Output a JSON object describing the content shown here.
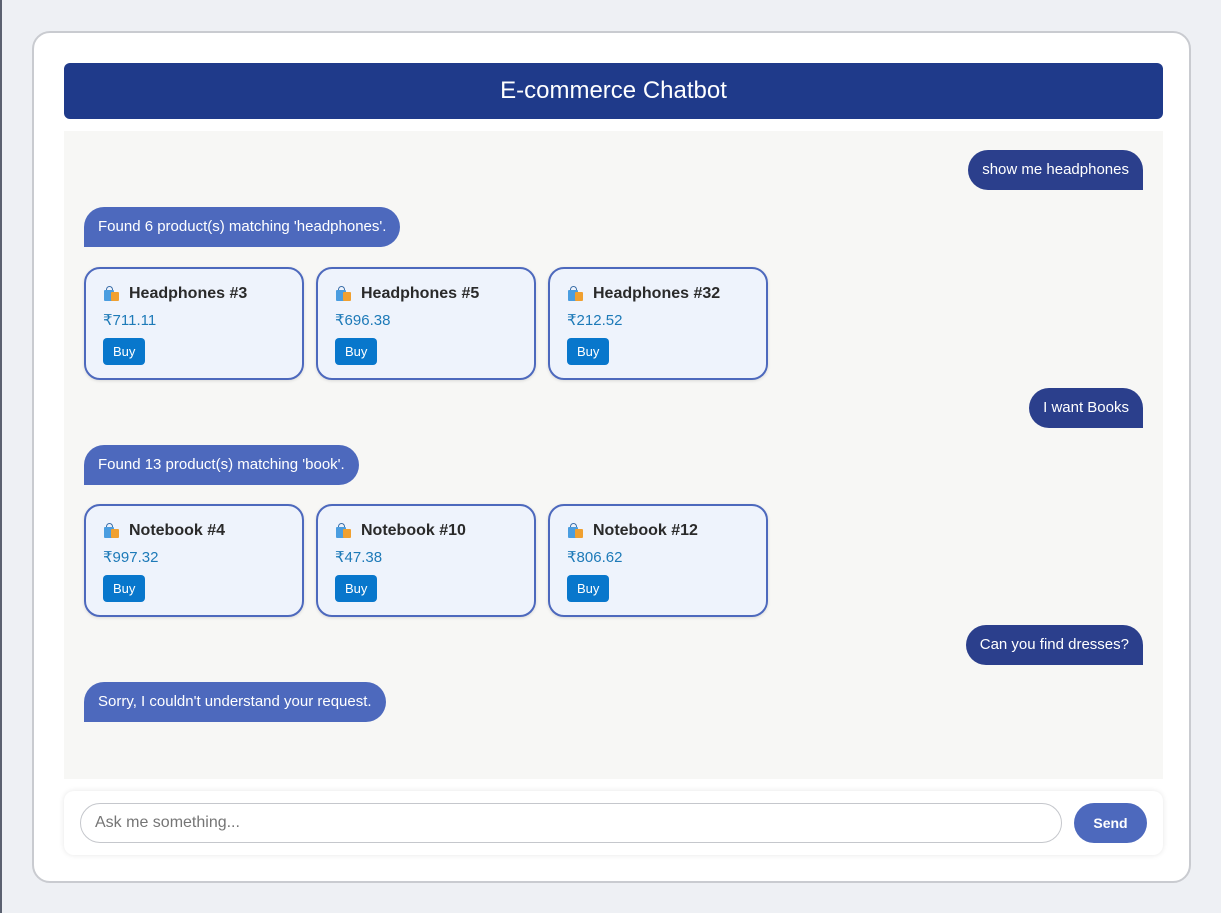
{
  "header": {
    "title": "E-commerce Chatbot"
  },
  "messages": [
    {
      "role": "user",
      "text": "show me headphones"
    },
    {
      "role": "bot",
      "text": "Found 6 product(s) matching 'headphones'."
    },
    {
      "role": "products",
      "items": [
        {
          "name": "Headphones #3",
          "price": "₹711.11",
          "button": "Buy",
          "icon": "shopping-bags-icon"
        },
        {
          "name": "Headphones #5",
          "price": "₹696.38",
          "button": "Buy",
          "icon": "shopping-bags-icon"
        },
        {
          "name": "Headphones #32",
          "price": "₹212.52",
          "button": "Buy",
          "icon": "shopping-bags-icon"
        }
      ]
    },
    {
      "role": "user",
      "text": "I want Books"
    },
    {
      "role": "bot",
      "text": "Found 13 product(s) matching 'book'."
    },
    {
      "role": "products",
      "items": [
        {
          "name": "Notebook #4",
          "price": "₹997.32",
          "button": "Buy",
          "icon": "shopping-bags-icon"
        },
        {
          "name": "Notebook #10",
          "price": "₹47.38",
          "button": "Buy",
          "icon": "shopping-bags-icon"
        },
        {
          "name": "Notebook #12",
          "price": "₹806.62",
          "button": "Buy",
          "icon": "shopping-bags-icon"
        }
      ]
    },
    {
      "role": "user",
      "text": "Can you find dresses?"
    },
    {
      "role": "bot",
      "text": "Sorry, I couldn't understand your request."
    }
  ],
  "input": {
    "placeholder": "Ask me something...",
    "value": ""
  },
  "send_button": {
    "label": "Send"
  },
  "colors": {
    "header": "#1f3a8a",
    "user_bubble": "#2b3f8c",
    "bot_bubble": "#4d69bd",
    "buy_button": "#0877cc",
    "price_text": "#1d7ab8"
  }
}
